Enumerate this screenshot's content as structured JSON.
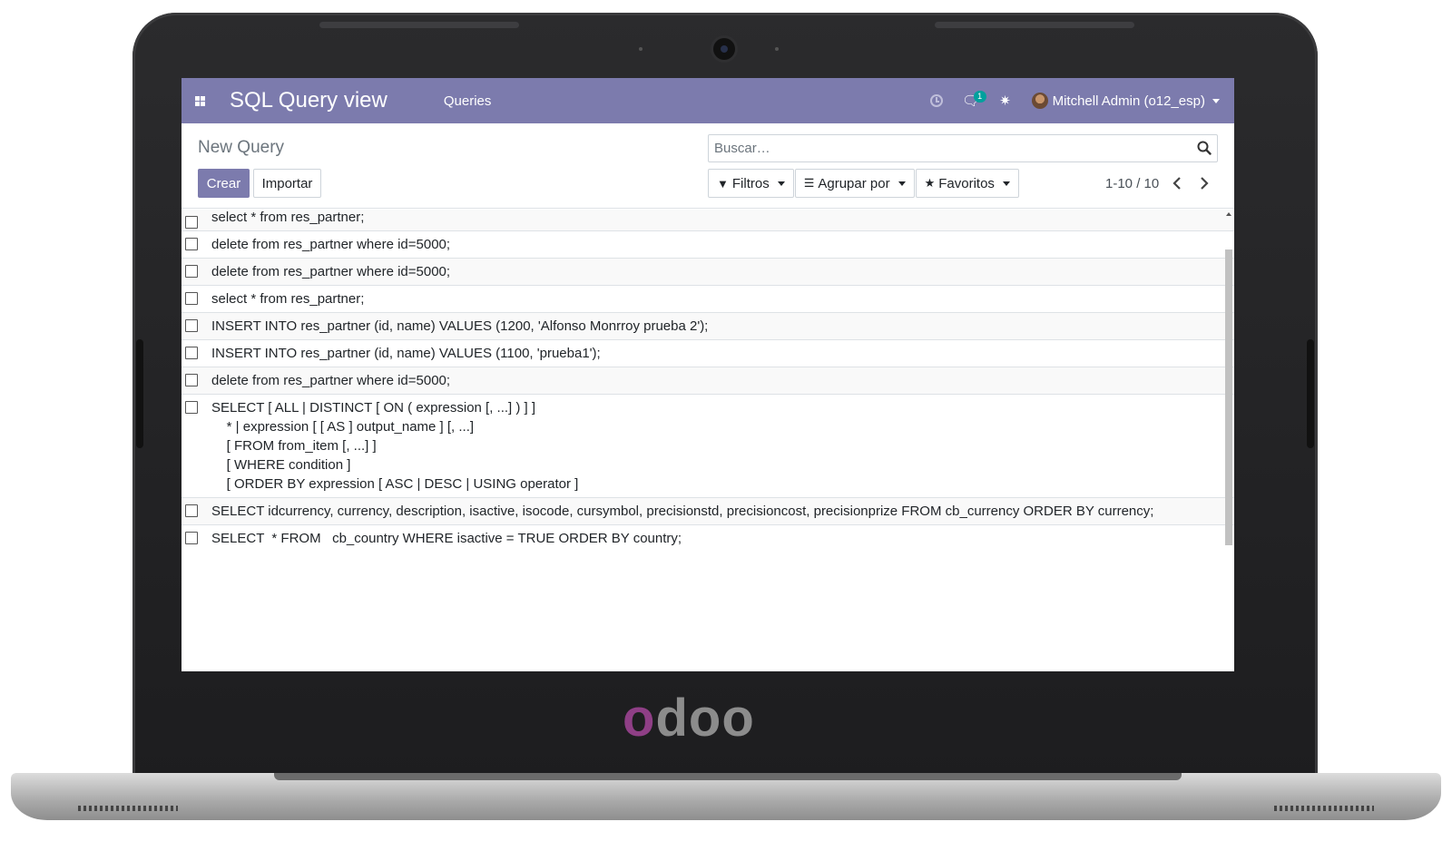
{
  "app": {
    "title": "SQL Query view",
    "menu_item": "Queries",
    "brand_logo": "odoo"
  },
  "navbar": {
    "messages_count": "1",
    "user": "Mitchell Admin (o12_esp)",
    "icons": [
      "apps-grid-icon",
      "clock-icon",
      "chat-icon",
      "bug-icon"
    ]
  },
  "control_panel": {
    "breadcrumb": "New Query",
    "search_placeholder": "Buscar…",
    "create_label": "Crear",
    "import_label": "Importar",
    "filters_label": "Filtros",
    "group_by_label": "Agrupar por",
    "favorites_label": "Favoritos",
    "pager": "1-10 / 10"
  },
  "queries": [
    "select * from res_partner;",
    "delete from res_partner where id=5000;",
    "delete from res_partner where id=5000;",
    "select * from res_partner;",
    "INSERT INTO res_partner (id, name) VALUES (1200, 'Alfonso Monrroy prueba 2');",
    "INSERT INTO res_partner (id, name) VALUES (1100, 'prueba1');",
    "delete from res_partner where id=5000;",
    "SELECT [ ALL | DISTINCT [ ON ( expression [, ...] ) ] ]\n    * | expression [ [ AS ] output_name ] [, ...]\n    [ FROM from_item [, ...] ]\n    [ WHERE condition ]\n    [ ORDER BY expression [ ASC | DESC | USING operator ]",
    "SELECT idcurrency, currency, description, isactive, isocode, cursymbol, precisionstd, precisioncost, precisionprize FROM cb_currency ORDER BY currency;",
    "SELECT  * FROM   cb_country WHERE isactive = TRUE ORDER BY country;"
  ],
  "colors": {
    "navbar": "#7c7bad",
    "primary_button": "#7c7bad",
    "badge": "#00a09d",
    "logo_accent": "#8f3f86"
  }
}
